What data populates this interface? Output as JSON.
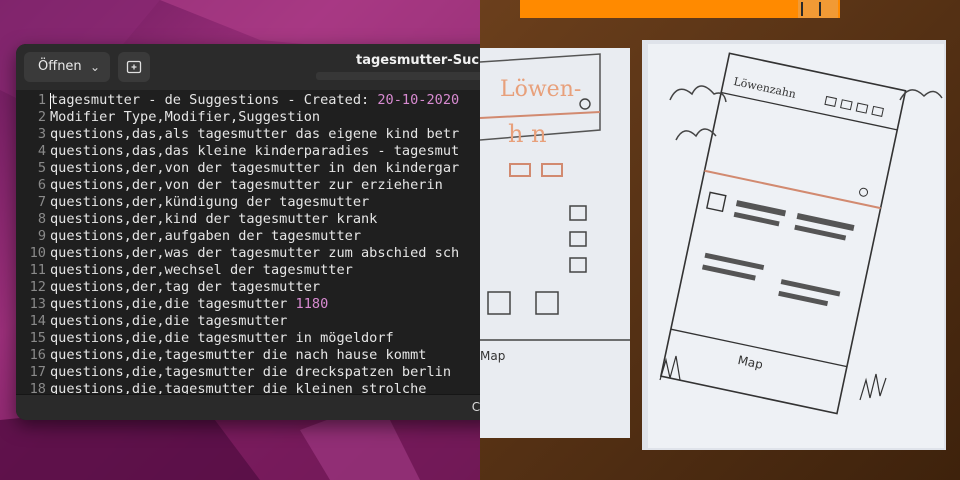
{
  "editor": {
    "open_label": "Öffnen",
    "title": "tagesmutter-Suchbe",
    "status_language": "CSV",
    "lines": [
      {
        "n": "1",
        "pre": "tagesmutter - de Suggestions - Created: ",
        "hl": "20-10-2020",
        "post": ""
      },
      {
        "n": "2",
        "pre": "Modifier Type,Modifier,Suggestion",
        "hl": "",
        "post": ""
      },
      {
        "n": "3",
        "pre": "questions,das,als tagesmutter das eigene kind betr",
        "hl": "",
        "post": ""
      },
      {
        "n": "4",
        "pre": "questions,das,das kleine kinderparadies - tagesmut",
        "hl": "",
        "post": ""
      },
      {
        "n": "5",
        "pre": "questions,der,von der tagesmutter in den kindergar",
        "hl": "",
        "post": ""
      },
      {
        "n": "6",
        "pre": "questions,der,von der tagesmutter zur erzieherin",
        "hl": "",
        "post": ""
      },
      {
        "n": "7",
        "pre": "questions,der,kündigung der tagesmutter",
        "hl": "",
        "post": ""
      },
      {
        "n": "8",
        "pre": "questions,der,kind der tagesmutter krank",
        "hl": "",
        "post": ""
      },
      {
        "n": "9",
        "pre": "questions,der,aufgaben der tagesmutter",
        "hl": "",
        "post": ""
      },
      {
        "n": "10",
        "pre": "questions,der,was der tagesmutter zum abschied sch",
        "hl": "",
        "post": ""
      },
      {
        "n": "11",
        "pre": "questions,der,wechsel der tagesmutter",
        "hl": "",
        "post": ""
      },
      {
        "n": "12",
        "pre": "questions,der,tag der tagesmutter",
        "hl": "",
        "post": ""
      },
      {
        "n": "13",
        "pre": "questions,die,die tagesmutter ",
        "hl": "1180",
        "post": ""
      },
      {
        "n": "14",
        "pre": "questions,die,die tagesmutter",
        "hl": "",
        "post": ""
      },
      {
        "n": "15",
        "pre": "questions,die,die tagesmutter in mögeldorf",
        "hl": "",
        "post": ""
      },
      {
        "n": "16",
        "pre": "questions,die,tagesmutter die nach hause kommt",
        "hl": "",
        "post": ""
      },
      {
        "n": "17",
        "pre": "questions,die,tagesmutter die dreckspatzen berlin",
        "hl": "",
        "post": ""
      },
      {
        "n": "18",
        "pre": "questions,die,tagesmutter die kleinen strolche",
        "hl": "",
        "post": ""
      }
    ]
  },
  "sketch": {
    "card_left_heading": "Löwen-",
    "card_left_subheading": "h n",
    "card_left_map_label": "Map",
    "card_right_heading": "Löwenzahn",
    "card_right_map_label": "Map"
  },
  "icons": {
    "open_dropdown": "chevron-down-icon",
    "new_tab": "new-tab-icon"
  },
  "colors": {
    "number_highlight": "#d78ad0",
    "editor_bg": "#1f1f1f",
    "pencil": "#ff8a00"
  }
}
